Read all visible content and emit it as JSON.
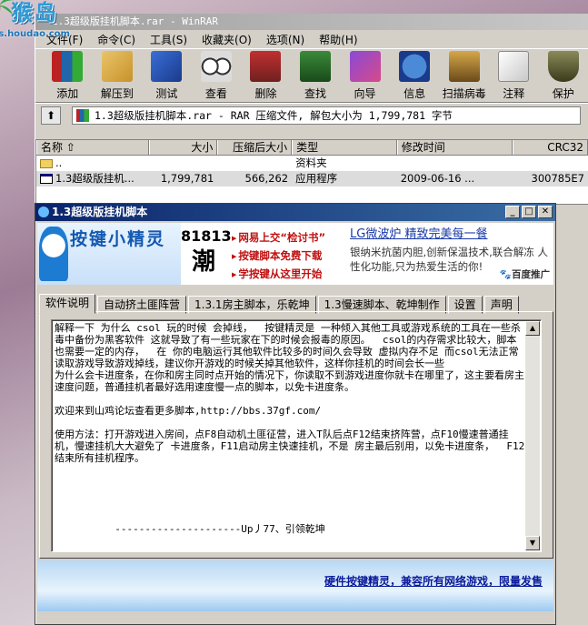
{
  "winrar": {
    "title": "1.3超级版挂机脚本.rar - WinRAR",
    "menu": [
      "文件(F)",
      "命令(C)",
      "工具(S)",
      "收藏夹(O)",
      "选项(N)",
      "帮助(H)"
    ],
    "toolbar": [
      "添加",
      "解压到",
      "测试",
      "查看",
      "删除",
      "查找",
      "向导",
      "信息",
      "扫描病毒",
      "注释",
      "保护"
    ],
    "path": "1.3超级版挂机脚本.rar - RAR 压缩文件, 解包大小为 1,799,781 字节",
    "columns": [
      "名称",
      "大小",
      "压缩后大小",
      "类型",
      "修改时间",
      "CRC32"
    ],
    "rows": [
      {
        "name": "..",
        "size": "",
        "packed": "",
        "type": "资料夹",
        "modified": "",
        "crc": ""
      },
      {
        "name": "1.3超级版挂机...",
        "size": "1,799,781",
        "packed": "566,262",
        "type": "应用程序",
        "modified": "2009-06-16 ...",
        "crc": "300785E7"
      }
    ]
  },
  "watermark": {
    "text": "猴岛",
    "url": "bbs.houdao.com"
  },
  "app": {
    "title": "1.3超级版挂机脚本",
    "logo": "按键小精灵",
    "logo_num": "81813",
    "logo_char": "潮",
    "links": [
      "网易上交“检讨书”",
      "按键脚本免费下载",
      "学按键从这里开始"
    ],
    "ad_headline": "LG微波炉 精致完美每一餐",
    "ad_body": "银纳米抗菌内胆,创新保温技术,联合解冻 人性化功能,只为热爱生活的你!",
    "ad_brand": "百度推广",
    "tabs": [
      "软件说明",
      "自动挤土匪阵营",
      "1.3.1房主脚本，乐乾坤",
      "1.3慢速脚本、乾坤制作",
      "设置",
      "声明"
    ],
    "content": "解释一下 为什么 csol 玩的时候 会掉线，  按键精灵是 一种倾入其他工具或游戏系统的工具在一些杀毒中备份为黑客软件 这就导致了有一些玩家在下的时候会报毒的原因。  csol的内存需求比较大，脚本也需要一定的内存，  在 你的电脑运行其他软件比较多的时间久会导致 虚拟内存不足 而csol无法正常读取游戏导致游戏掉线，建议你开游戏的时候关掉其他软件，这样你挂机的时间会长一些\n为什么会卡进度条，在你和房主同时点开始的情况下，你读取不到游戏进度你就卡在哪里了，这主要看房主速度问题，普通挂机者最好选用速度慢一点的脚本，以免卡进度条。\n\n欢迎来到山鸡论坛查看更多脚本,http://bbs.37gf.com/\n\n使用方法：打开游戏进入房间，点F8自动机土匪征营，进入T队后点F12结束挤阵营，点F10慢速普通挂机，慢速挂机大大避免了 卡进度条，F11启动房主快速挂机，不是 房主最后别用，以免卡进度条，  F12 结束所有挂机程序。\n\n\n\n\n\n          ---------------------Up丿77、引领乾坤",
    "footer_link": "硬件按键精灵，兼容所有网络游戏，限量发售"
  }
}
